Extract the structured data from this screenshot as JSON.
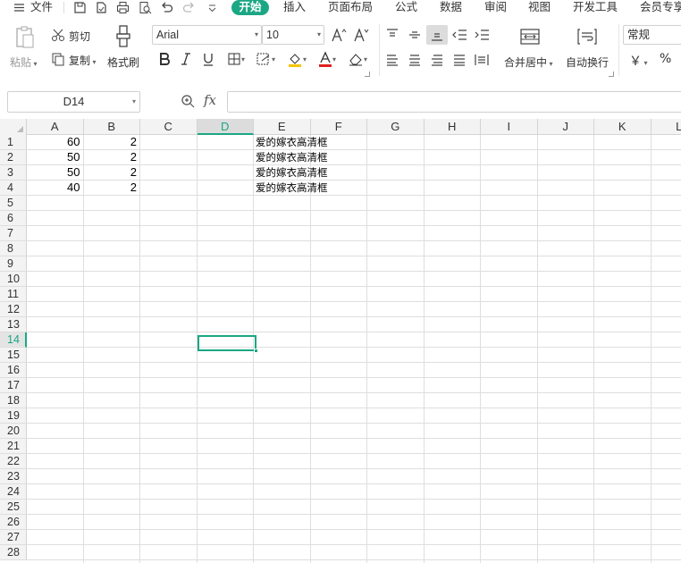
{
  "menubar": {
    "file_label": "文件",
    "tabs": [
      "开始",
      "插入",
      "页面布局",
      "公式",
      "数据",
      "审阅",
      "视图",
      "开发工具",
      "会员专享"
    ]
  },
  "ribbon": {
    "paste_label": "粘贴",
    "cut_label": "剪切",
    "copy_label": "复制",
    "format_painter_label": "格式刷",
    "font_name": "Arial",
    "font_size": "10",
    "merge_center_label": "合并居中",
    "wrap_text_label": "自动换行",
    "number_format": "常规",
    "currency_symbol": "￥",
    "percent_symbol": "%"
  },
  "formula_bar": {
    "name_box": "D14",
    "fx_label": "fx",
    "formula": ""
  },
  "sheet": {
    "columns": [
      "A",
      "B",
      "C",
      "D",
      "E",
      "F",
      "G",
      "H",
      "I",
      "J",
      "K",
      "L"
    ],
    "rows": [
      "1",
      "2",
      "3",
      "4",
      "5",
      "6",
      "7",
      "8",
      "9",
      "10",
      "11",
      "12",
      "13",
      "14",
      "15",
      "16",
      "17",
      "18",
      "19",
      "20",
      "21",
      "22",
      "23",
      "24",
      "25",
      "26",
      "27",
      "28"
    ],
    "selected_column": "D",
    "selected_row": "14",
    "data": [
      {
        "A": "60",
        "B": "2",
        "E": "爱的嫁衣高清框"
      },
      {
        "A": "50",
        "B": "2",
        "E": "爱的嫁衣高清框"
      },
      {
        "A": "50",
        "B": "2",
        "E": "爱的嫁衣高清框"
      },
      {
        "A": "40",
        "B": "2",
        "E": "爱的嫁衣高清框"
      }
    ]
  },
  "colors": {
    "accent": "#1ba784",
    "header_bg": "#f3f3f3",
    "gridline": "#dedede"
  }
}
